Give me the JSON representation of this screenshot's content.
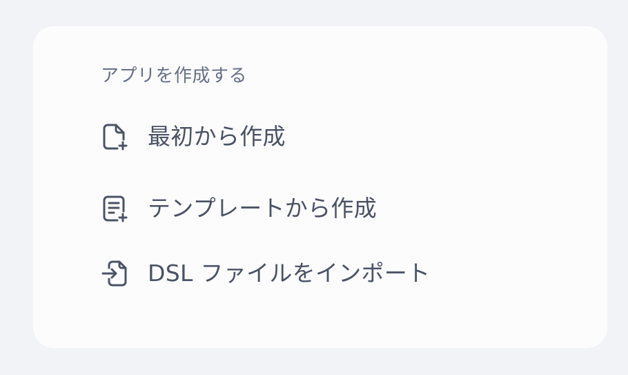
{
  "create_app": {
    "section_title": "アプリを作成する",
    "items": [
      {
        "icon": "file-plus-icon",
        "label": "最初から作成"
      },
      {
        "icon": "file-list-plus-icon",
        "label": "テンプレートから作成"
      },
      {
        "icon": "file-import-icon",
        "label": "DSL ファイルをインポート"
      }
    ]
  },
  "colors": {
    "page_background": "#f2f3f7",
    "card_background": "#fcfcfd",
    "section_title": "#667085",
    "item_text": "#4a5264",
    "icon_stroke": "#4a5264"
  }
}
